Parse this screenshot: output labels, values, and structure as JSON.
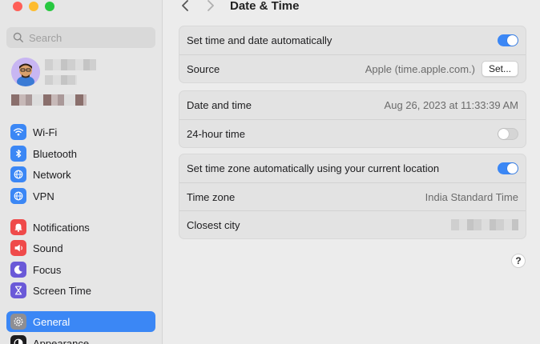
{
  "sidebar": {
    "search_placeholder": "Search",
    "items": [
      {
        "label": "Wi-Fi",
        "icon": "wifi-icon",
        "color": "#3b87f5"
      },
      {
        "label": "Bluetooth",
        "icon": "bluetooth-icon",
        "color": "#3b87f5"
      },
      {
        "label": "Network",
        "icon": "globe-icon",
        "color": "#3b87f5"
      },
      {
        "label": "VPN",
        "icon": "vpn-globe-icon",
        "color": "#3b87f5"
      },
      {
        "label": "Notifications",
        "icon": "bell-icon",
        "color": "#ef4a4a"
      },
      {
        "label": "Sound",
        "icon": "speaker-icon",
        "color": "#ef4a4a"
      },
      {
        "label": "Focus",
        "icon": "moon-icon",
        "color": "#6a59d8"
      },
      {
        "label": "Screen Time",
        "icon": "hourglass-icon",
        "color": "#6a59d8"
      },
      {
        "label": "General",
        "icon": "gear-icon",
        "color": "#8e8e93"
      },
      {
        "label": "Appearance",
        "icon": "appearance-icon",
        "color": "#1d1d1f"
      }
    ]
  },
  "header": {
    "title": "Date & Time"
  },
  "settings": {
    "auto_time": {
      "label": "Set time and date automatically",
      "enabled": true
    },
    "source": {
      "label": "Source",
      "value": "Apple (time.apple.com.)",
      "button": "Set..."
    },
    "date_time": {
      "label": "Date and time",
      "value": "Aug 26, 2023 at 11:33:39 AM"
    },
    "hour24": {
      "label": "24-hour time",
      "enabled": false
    },
    "auto_timezone": {
      "label": "Set time zone automatically using your current location",
      "enabled": true
    },
    "timezone": {
      "label": "Time zone",
      "value": "India Standard Time"
    },
    "closest_city": {
      "label": "Closest city"
    }
  },
  "help_label": "?"
}
